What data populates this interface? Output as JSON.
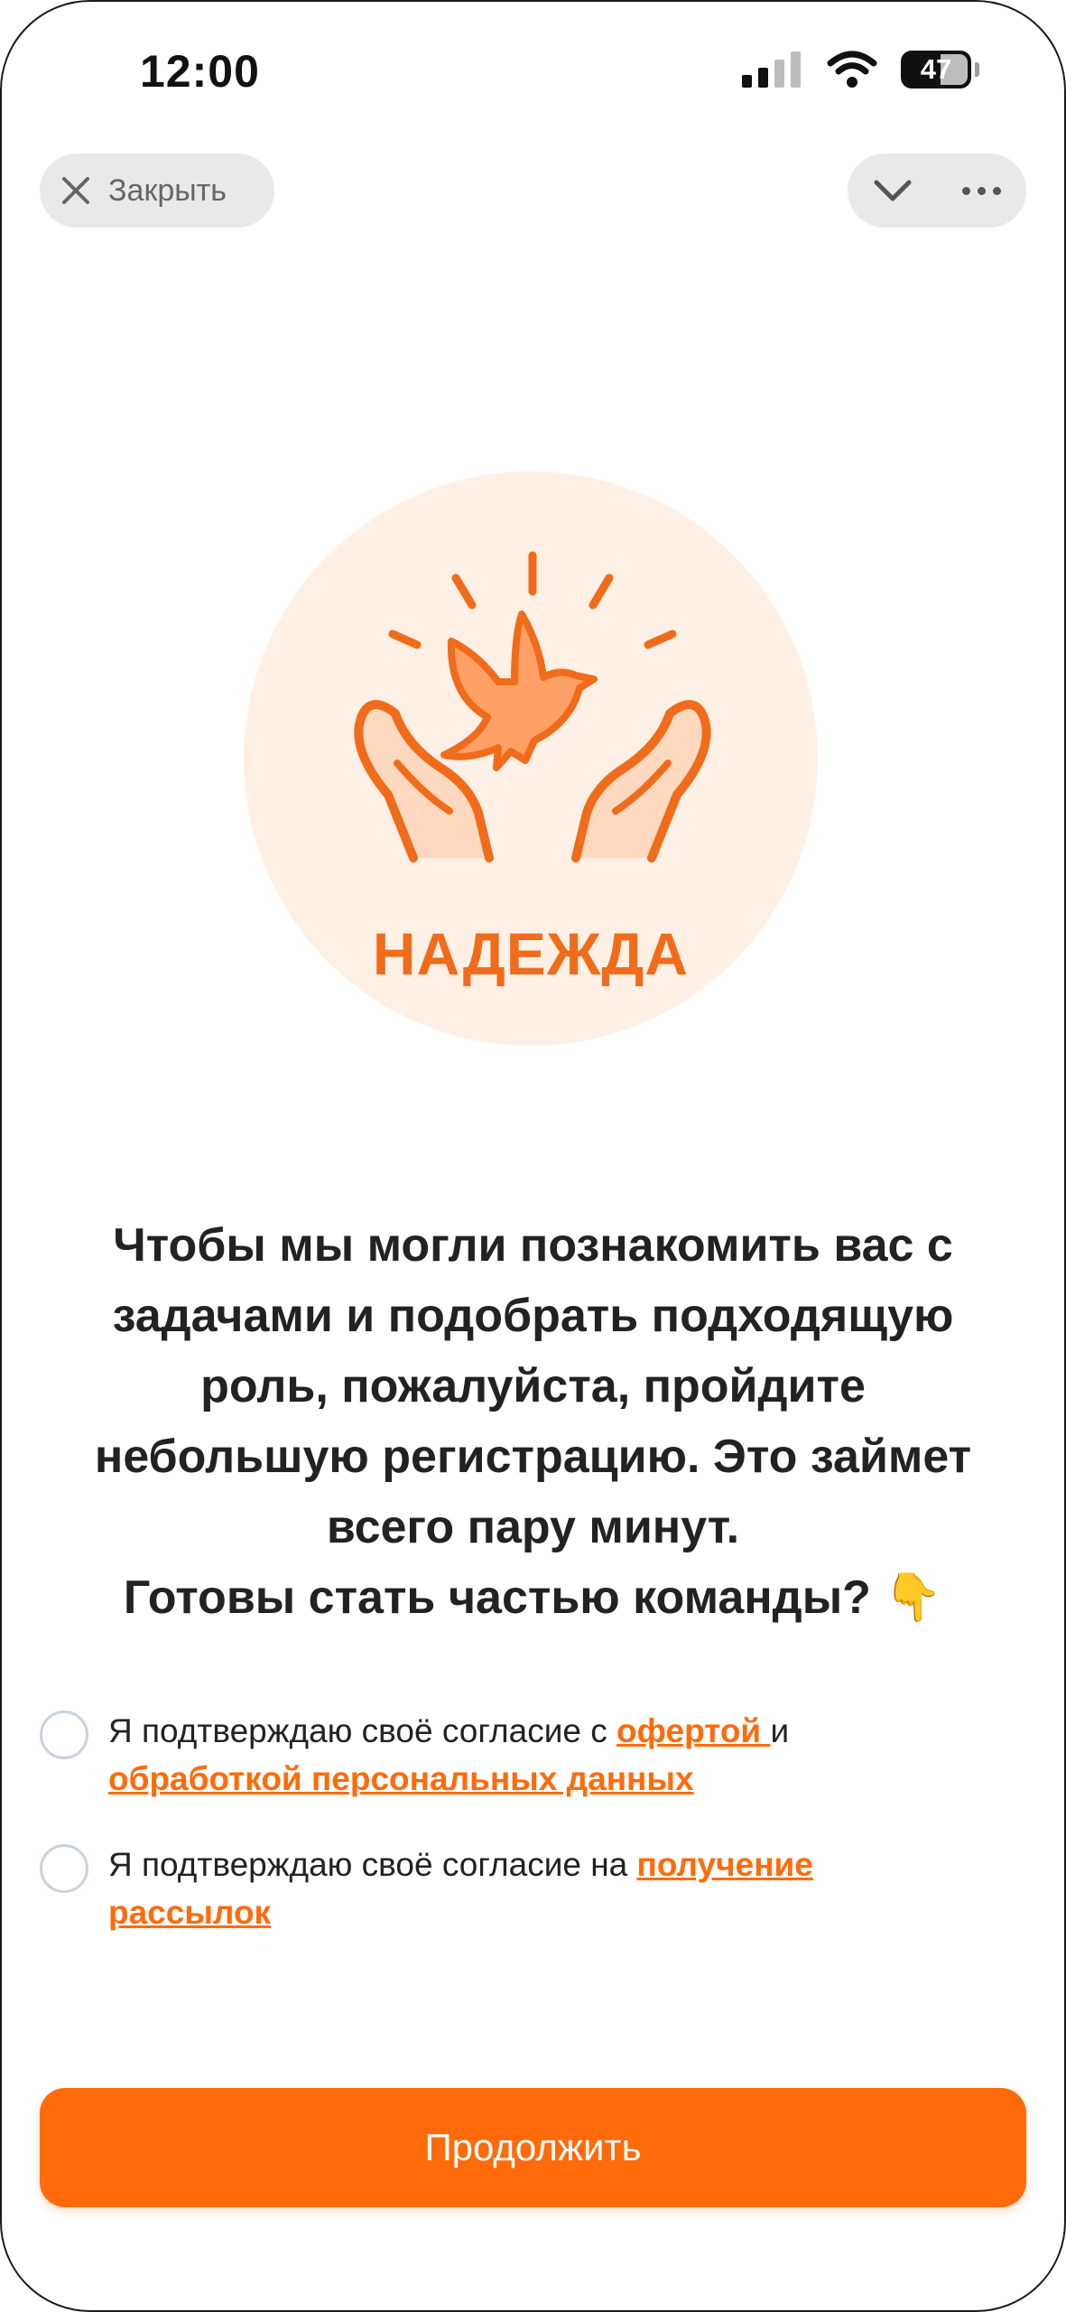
{
  "status_bar": {
    "time": "12:00",
    "battery": "47",
    "icons": [
      "signal-icon",
      "wifi-icon",
      "battery-icon"
    ]
  },
  "header": {
    "close_label": "Закрыть",
    "close_icon": "close-icon",
    "collapse_icon": "chevron-down-icon",
    "more_icon": "more-dots-icon"
  },
  "logo": {
    "text": "НАДЕЖДА",
    "icon": "dove-in-hands-icon"
  },
  "message": {
    "lines": [
      "Чтобы мы могли познакомить вас с",
      "задачами и подобрать подходящую",
      "роль, пожалуйста, пройдите",
      "небольшую регистрацию. Это займет",
      "всего пару минут.",
      "Готовы стать частью команды? 👇"
    ]
  },
  "consents": [
    {
      "text_before": "Я подтверждаю своё согласие с ",
      "link1": "офертой ",
      "text_middle": "и",
      "link2": "обработкой персональных данных",
      "checked": false
    },
    {
      "text_before": "Я подтверждаю своё согласие на ",
      "link1": "получение рассылок",
      "checked": false
    }
  ],
  "continue_label": "Продолжить",
  "colors": {
    "accent": "#ff6b0a",
    "logo_orange": "#f06c1b",
    "logo_bg": "#fff0e6",
    "pill_bg": "#e9e9e9"
  }
}
